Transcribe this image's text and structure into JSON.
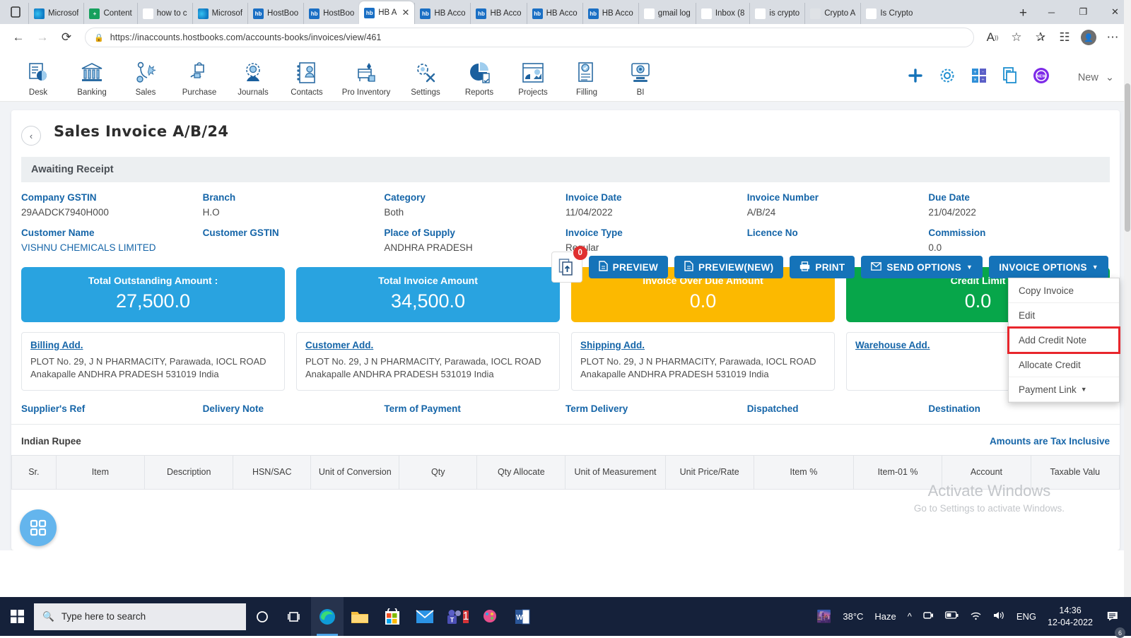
{
  "browser": {
    "tabs": [
      {
        "title": "Microsof",
        "icon": "edge-icon",
        "fav": "fav-edge",
        "active": false
      },
      {
        "title": "Content",
        "icon": "content-icon",
        "fav": "fav-teams",
        "active": false
      },
      {
        "title": "how to c",
        "icon": "bing-icon",
        "fav": "fav-bing",
        "active": false
      },
      {
        "title": "Microsof",
        "icon": "edge-icon",
        "fav": "fav-edge",
        "active": false
      },
      {
        "title": "HostBoo",
        "icon": "hostbooks-icon",
        "fav": "fav-hb",
        "active": false
      },
      {
        "title": "HostBoo",
        "icon": "hostbooks-icon",
        "fav": "fav-hb",
        "active": false
      },
      {
        "title": "HB A",
        "icon": "hostbooks-icon",
        "fav": "fav-hb",
        "active": true
      },
      {
        "title": "HB Acco",
        "icon": "hostbooks-icon",
        "fav": "fav-hb",
        "active": false
      },
      {
        "title": "HB Acco",
        "icon": "hostbooks-icon",
        "fav": "fav-hb",
        "active": false
      },
      {
        "title": "HB Acco",
        "icon": "hostbooks-icon",
        "fav": "fav-hb",
        "active": false
      },
      {
        "title": "HB Acco",
        "icon": "hostbooks-icon",
        "fav": "fav-hb",
        "active": false
      },
      {
        "title": "gmail log",
        "icon": "bing-icon",
        "fav": "fav-bing",
        "active": false
      },
      {
        "title": "Inbox (8",
        "icon": "gmail-icon",
        "fav": "fav-gmail",
        "active": false
      },
      {
        "title": "is crypto",
        "icon": "bing-icon",
        "fav": "fav-bing",
        "active": false
      },
      {
        "title": "Crypto A",
        "icon": "generic-page-icon",
        "fav": "fav-grey",
        "active": false
      },
      {
        "title": "Is Crypto",
        "icon": "generic-page-icon",
        "fav": "fav-dark",
        "active": false
      }
    ],
    "newtab_label": "+",
    "window_controls": {
      "minimize": "─",
      "maximize": "❐",
      "close": "✕"
    },
    "url": "https://inaccounts.hostbooks.com/accounts-books/invoices/view/461",
    "back_icon": "back-arrow-icon",
    "forward_icon": "forward-arrow-icon",
    "reload_icon": "reload-icon",
    "lock_icon": "lock-icon",
    "read_aloud_icon": "read-aloud-icon",
    "favorite_icon": "star-icon",
    "collections_icon": "collections-icon",
    "favorites_bar_icon": "favorites-icon",
    "profile_icon": "profile-avatar-icon",
    "more_icon": "more-options-icon"
  },
  "appnav": {
    "modules": [
      {
        "label": "Desk",
        "icon": "desk-icon"
      },
      {
        "label": "Banking",
        "icon": "banking-icon"
      },
      {
        "label": "Sales",
        "icon": "sales-icon"
      },
      {
        "label": "Purchase",
        "icon": "purchase-icon"
      },
      {
        "label": "Journals",
        "icon": "journals-icon"
      },
      {
        "label": "Contacts",
        "icon": "contacts-icon"
      },
      {
        "label": "Pro Inventory",
        "icon": "pro-inventory-icon"
      },
      {
        "label": "Settings",
        "icon": "settings-icon"
      },
      {
        "label": "Reports",
        "icon": "reports-icon"
      },
      {
        "label": "Projects",
        "icon": "projects-icon"
      },
      {
        "label": "Filling",
        "icon": "filling-icon"
      },
      {
        "label": "BI",
        "icon": "bi-icon"
      }
    ],
    "right_icons": [
      "add-icon",
      "gear-icon",
      "calculator-icon",
      "notes-icon",
      "new-badge-icon"
    ],
    "new_label": "New"
  },
  "page": {
    "title": "Sales Invoice A/B/24",
    "back_icon": "chevron-left-icon",
    "status": "Awaiting Receipt",
    "upload": {
      "icon": "upload-document-icon",
      "badge": "0"
    },
    "buttons": [
      {
        "label": "PREVIEW",
        "icon": "file-icon",
        "caret": false
      },
      {
        "label": "PREVIEW(NEW)",
        "icon": "file-icon",
        "caret": false
      },
      {
        "label": "PRINT",
        "icon": "printer-icon",
        "caret": false
      },
      {
        "label": "SEND OPTIONS",
        "icon": "envelope-icon",
        "caret": true
      },
      {
        "label": "INVOICE OPTIONS",
        "icon": "",
        "caret": true
      }
    ],
    "dropdown": {
      "items": [
        {
          "label": "Copy Invoice",
          "highlighted": false,
          "caret": false
        },
        {
          "label": "Edit",
          "highlighted": false,
          "caret": false
        },
        {
          "label": "Add Credit Note",
          "highlighted": true,
          "caret": false
        },
        {
          "label": "Allocate Credit",
          "highlighted": false,
          "caret": false
        },
        {
          "label": "Payment Link",
          "highlighted": false,
          "caret": true
        }
      ],
      "highlight_color": "#e8262c"
    },
    "fields_row1": [
      {
        "label": "Company GSTIN",
        "value": "29AADCK7940H000"
      },
      {
        "label": "Branch",
        "value": "H.O"
      },
      {
        "label": "Category",
        "value": "Both"
      },
      {
        "label": "Invoice Date",
        "value": "11/04/2022"
      },
      {
        "label": "Invoice Number",
        "value": "A/B/24"
      },
      {
        "label": "Due Date",
        "value": "21/04/2022"
      }
    ],
    "fields_row2": [
      {
        "label": "Customer Name",
        "value": "VISHNU CHEMICALS LIMITED",
        "link": true
      },
      {
        "label": "Customer GSTIN",
        "value": ""
      },
      {
        "label": "Place of Supply",
        "value": "ANDHRA PRADESH"
      },
      {
        "label": "Invoice Type",
        "value": "Regular"
      },
      {
        "label": "Licence No",
        "value": ""
      },
      {
        "label": "Commission",
        "value": "0.0"
      }
    ],
    "kpis": [
      {
        "label": "Total Outstanding Amount :",
        "value": "27,500.0",
        "color": "#29a3e0"
      },
      {
        "label": "Total Invoice Amount",
        "value": "34,500.0",
        "color": "#29a3e0"
      },
      {
        "label": "Invoice Over Due Amount",
        "value": "0.0",
        "color": "#fcb900"
      },
      {
        "label": "Credit Limit",
        "value": "0.0",
        "color": "#07a64a"
      }
    ],
    "addresses": [
      {
        "title": "Billing Add.",
        "body": "PLOT No. 29, J N PHARMACITY, Parawada, IOCL ROAD Anakapalle ANDHRA PRADESH 531019 India"
      },
      {
        "title": "Customer Add.",
        "body": "PLOT No. 29, J N PHARMACITY, Parawada, IOCL ROAD Anakapalle ANDHRA PRADESH 531019 India"
      },
      {
        "title": "Shipping Add.",
        "body": "PLOT No. 29, J N PHARMACITY, Parawada, IOCL ROAD Anakapalle ANDHRA PRADESH 531019 India"
      },
      {
        "title": "Warehouse Add.",
        "body": ""
      }
    ],
    "ref_row": [
      "Supplier's Ref",
      "Delivery Note",
      "Term of Payment",
      "Term Delivery",
      "Dispatched",
      "Destination"
    ],
    "currency": "Indian Rupee",
    "tax_note": "Amounts are Tax Inclusive",
    "table_headers": [
      "Sr.",
      "Item",
      "Description",
      "HSN/SAC",
      "Unit of Conversion",
      "Qty",
      "Qty Allocate",
      "Unit of Measurement",
      "Unit Price/Rate",
      "Item %",
      "Item-01 %",
      "Account",
      "Taxable Valu"
    ],
    "fab_icon": "grid-apps-icon",
    "watermark": {
      "line1": "Activate Windows",
      "line2": "Go to Settings to activate Windows."
    }
  },
  "taskbar": {
    "start_icon": "windows-start-icon",
    "search_placeholder": "Type here to search",
    "search_icon": "search-icon",
    "icons": [
      {
        "name": "cortana-icon"
      },
      {
        "name": "task-view-icon"
      },
      {
        "name": "edge-browser-icon"
      },
      {
        "name": "file-explorer-icon"
      },
      {
        "name": "microsoft-store-icon"
      },
      {
        "name": "mail-icon"
      },
      {
        "name": "teams-icon"
      },
      {
        "name": "paint-icon"
      },
      {
        "name": "word-icon"
      }
    ],
    "weather": {
      "icon": "haze-icon",
      "temp": "38°C",
      "condition": "Haze"
    },
    "tray_icons": [
      "chevron-up-icon",
      "camera-icon",
      "battery-icon",
      "wifi-icon",
      "volume-icon"
    ],
    "language": "ENG",
    "time": "14:36",
    "date": "12-04-2022",
    "notification_icon": "notification-icon",
    "notification_count": "6"
  }
}
